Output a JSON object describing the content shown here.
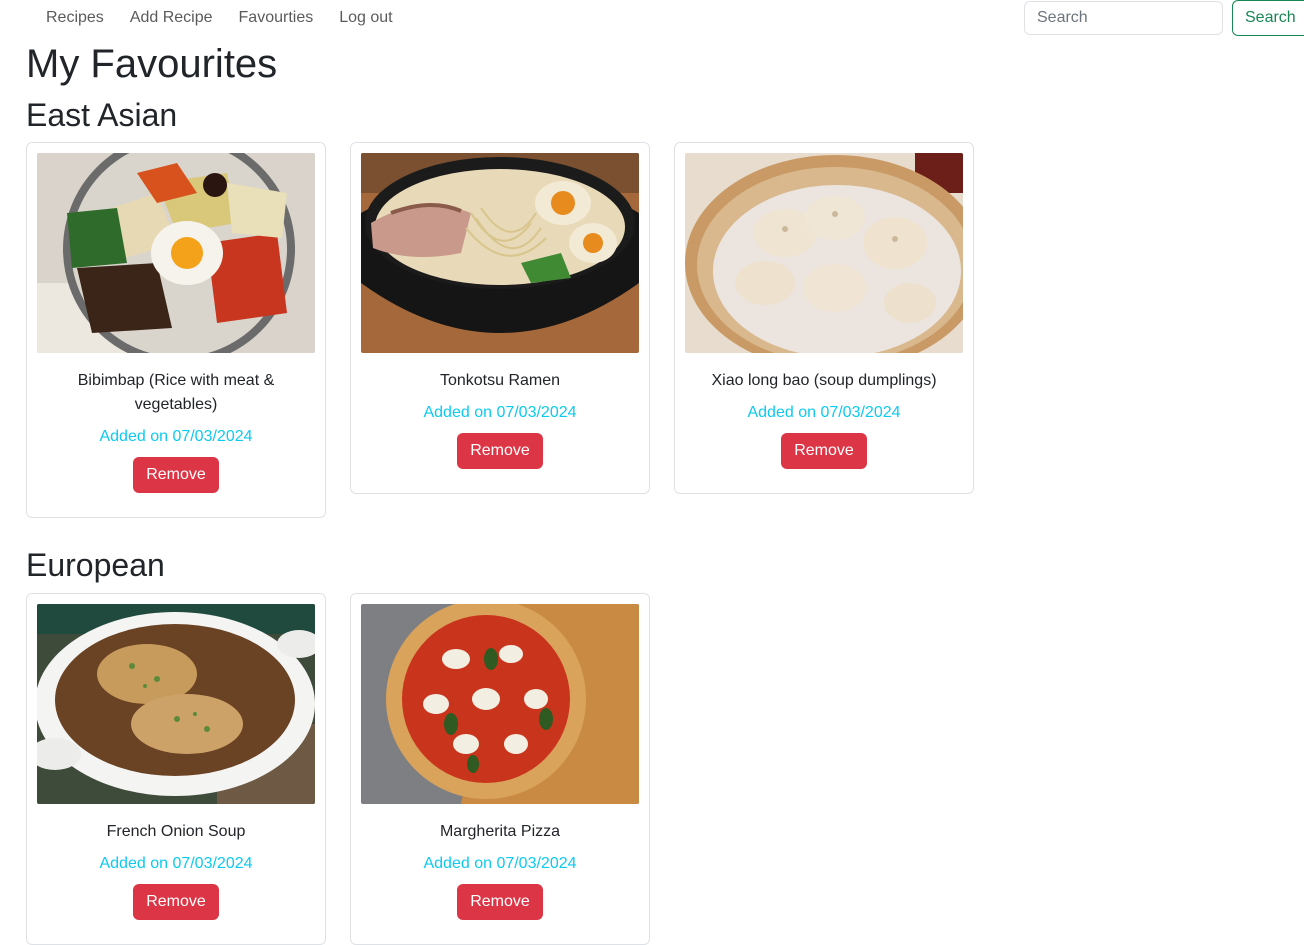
{
  "nav": {
    "links": [
      "Recipes",
      "Add Recipe",
      "Favourties",
      "Log out"
    ],
    "search_placeholder": "Search",
    "search_button": "Search"
  },
  "page_title": "My Favourites",
  "sections": [
    {
      "title": "East Asian",
      "cards": [
        {
          "title": "Bibimbap (Rice with meat & vegetables)",
          "date": "Added on 07/03/2024",
          "button": "Remove",
          "image": "bibimbap-photo"
        },
        {
          "title": "Tonkotsu Ramen",
          "date": "Added on 07/03/2024",
          "button": "Remove",
          "image": "ramen-photo"
        },
        {
          "title": "Xiao long bao (soup dumplings)",
          "date": "Added on 07/03/2024",
          "button": "Remove",
          "image": "dumplings-photo"
        }
      ]
    },
    {
      "title": "European",
      "cards": [
        {
          "title": "French Onion Soup",
          "date": "Added on 07/03/2024",
          "button": "Remove",
          "image": "onion-soup-photo"
        },
        {
          "title": "Margherita Pizza",
          "date": "Added on 07/03/2024",
          "button": "Remove",
          "image": "pizza-photo"
        }
      ]
    }
  ]
}
